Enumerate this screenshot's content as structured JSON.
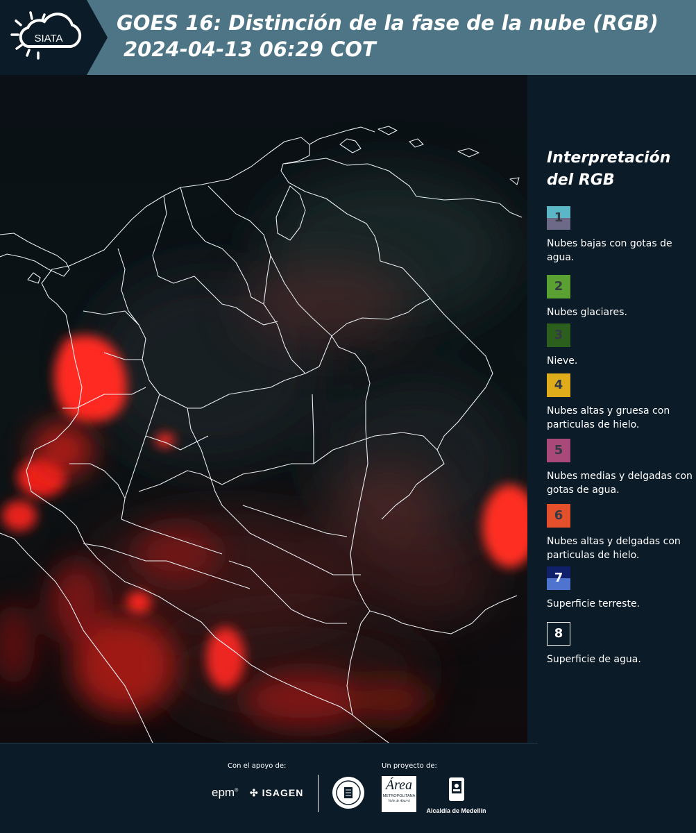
{
  "header": {
    "brand": "SIATA",
    "title_line1": "GOES 16: Distinción de la fase de la nube (RGB)",
    "title_line2": "2024-04-13 06:29 COT"
  },
  "legend": {
    "title_line1": "Interpretación",
    "title_line2": "del RGB",
    "items": [
      {
        "number": "1",
        "label": "Nubes bajas con gotas de agua.",
        "color_top": "#5bb7c6",
        "color_bottom": "#6c6a86"
      },
      {
        "number": "2",
        "label": "Nubes glaciares.",
        "color_top": "#5aa032",
        "color_bottom": "#5aa032"
      },
      {
        "number": "3",
        "label": "Nieve.",
        "color_top": "#2c5e1e",
        "color_bottom": "#2c5e1e"
      },
      {
        "number": "4",
        "label": "Nubes altas y gruesa con particulas de hielo.",
        "color_top": "#e1ac1c",
        "color_bottom": "#e1ac1c"
      },
      {
        "number": "5",
        "label": "Nubes medias y delgadas con gotas de agua.",
        "color_top": "#a8497a",
        "color_bottom": "#a8497a"
      },
      {
        "number": "6",
        "label": "Nubes altas y delgadas con particulas de hielo.",
        "color_top": "#e4502c",
        "color_bottom": "#e4502c"
      },
      {
        "number": "7",
        "label": "Superficie terreste.",
        "color_top": "#10206a",
        "color_bottom": "#4f74d0"
      },
      {
        "number": "8",
        "label": "Superficie de agua.",
        "color_top": "#0c1b28",
        "color_bottom": "#0c1b28"
      }
    ]
  },
  "footer": {
    "support_label": "Con el apoyo de:",
    "project_label": "Un proyecto de:",
    "sponsor1": "epm",
    "sponsor2": "ISAGEN",
    "partner1": "METROPOLITANA",
    "partner1_sub": "Valle de Aburrá",
    "partner2": "Alcaldía de Medellín"
  },
  "colors": {
    "header_bg": "#4d7585",
    "page_bg": "#0c1b28",
    "cloud_red": "#ff2a22"
  }
}
